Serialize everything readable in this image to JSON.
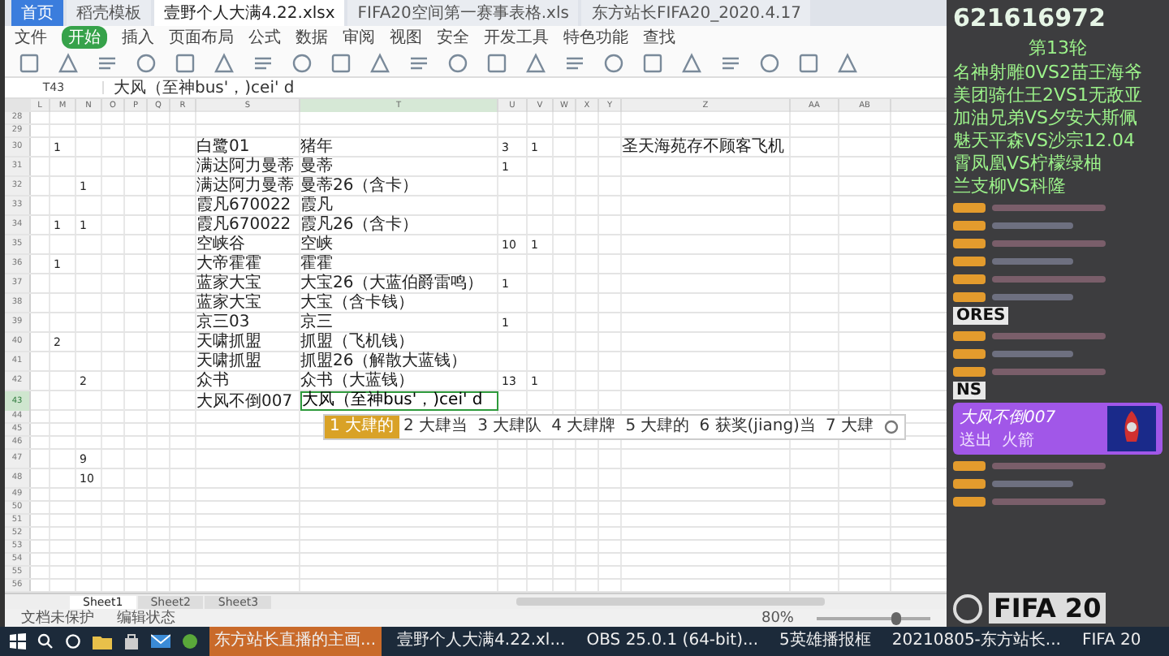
{
  "window": {
    "doc_tabs": [
      {
        "label": "首页",
        "selected": false
      },
      {
        "label": "稻壳模板",
        "selected": false
      },
      {
        "label": "壹野个人大满4.22.xlsx",
        "selected": true
      },
      {
        "label": "FIFA20空间第一赛事表格.xls",
        "selected": false
      },
      {
        "label": "东方站长FIFA20_2020.4.17",
        "selected": false
      }
    ],
    "menu": [
      {
        "label": "文件",
        "selected": false
      },
      {
        "label": "开始",
        "selected": true
      },
      {
        "label": "插入",
        "selected": false
      },
      {
        "label": "页面布局",
        "selected": false
      },
      {
        "label": "公式",
        "selected": false
      },
      {
        "label": "数据",
        "selected": false
      },
      {
        "label": "审阅",
        "selected": false
      },
      {
        "label": "视图",
        "selected": false
      },
      {
        "label": "安全",
        "selected": false
      },
      {
        "label": "开发工具",
        "selected": false
      },
      {
        "label": "特色功能",
        "selected": false
      },
      {
        "label": "查找",
        "selected": false
      }
    ],
    "cell_ref": "T43",
    "formula": "大风（至神bus'，)cei' d"
  },
  "sheet": {
    "columns": [
      "L",
      "M",
      "N",
      "O",
      "P",
      "Q",
      "R",
      "S",
      "T",
      "U",
      "V",
      "W",
      "X",
      "Y",
      "Z",
      "AA",
      "AB"
    ],
    "rows": [
      {
        "num": "28",
        "editing": false,
        "cells": []
      },
      {
        "num": "29",
        "editing": false,
        "cells": []
      },
      {
        "num": "30",
        "editing": false,
        "cells": [
          "",
          "1",
          "",
          "",
          "",
          "",
          "",
          "白鹭01",
          "猪年",
          "3",
          "1",
          "",
          "",
          "",
          "圣天海苑存不顾客飞机"
        ]
      },
      {
        "num": "31",
        "editing": false,
        "cells": [
          "",
          "",
          "",
          "",
          "",
          "",
          "",
          "满达阿力曼蒂",
          "曼蒂",
          "1"
        ]
      },
      {
        "num": "32",
        "editing": false,
        "cells": [
          "",
          "",
          "1",
          "",
          "",
          "",
          "",
          "满达阿力曼蒂",
          "曼蒂26（含卡）"
        ]
      },
      {
        "num": "33",
        "editing": false,
        "cells": [
          "",
          "",
          "",
          "",
          "",
          "",
          "",
          "霞凡670022",
          "霞凡"
        ]
      },
      {
        "num": "34",
        "editing": false,
        "cells": [
          "",
          "1",
          "1",
          "",
          "",
          "",
          "",
          "霞凡670022",
          "霞凡26（含卡）"
        ]
      },
      {
        "num": "35",
        "editing": false,
        "cells": [
          "",
          "",
          "",
          "",
          "",
          "",
          "",
          "空峡谷",
          "空峡",
          "10",
          "1"
        ]
      },
      {
        "num": "36",
        "editing": false,
        "cells": [
          "",
          "1",
          "",
          "",
          "",
          "",
          "",
          "大帝霍霍",
          "霍霍"
        ]
      },
      {
        "num": "37",
        "editing": false,
        "cells": [
          "",
          "",
          "",
          "",
          "",
          "",
          "",
          "蓝家大宝",
          "大宝26（大蓝伯爵雷鸣）",
          "1"
        ]
      },
      {
        "num": "38",
        "editing": false,
        "cells": [
          "",
          "",
          "",
          "",
          "",
          "",
          "",
          "蓝家大宝",
          "大宝（含卡钱）"
        ]
      },
      {
        "num": "39",
        "editing": false,
        "cells": [
          "",
          "",
          "",
          "",
          "",
          "",
          "",
          "京三03",
          "京三",
          "1"
        ]
      },
      {
        "num": "40",
        "editing": false,
        "cells": [
          "",
          "2",
          "",
          "",
          "",
          "",
          "",
          "天啸抓盟",
          "抓盟（飞机钱）"
        ]
      },
      {
        "num": "41",
        "editing": false,
        "cells": [
          "",
          "",
          "",
          "",
          "",
          "",
          "",
          "天啸抓盟",
          "抓盟26（解散大蓝钱）"
        ]
      },
      {
        "num": "42",
        "editing": false,
        "cells": [
          "",
          "",
          "2",
          "",
          "",
          "",
          "",
          "众书",
          "众书（大蓝钱）",
          "13",
          "1"
        ]
      },
      {
        "num": "43",
        "editing": true,
        "cells": [
          "",
          "",
          "",
          "",
          "",
          "",
          "",
          "大风不倒007",
          "大风（至神bus'，)cei' d"
        ]
      },
      {
        "num": "44",
        "editing": false,
        "cells": []
      },
      {
        "num": "45",
        "editing": false,
        "cells": []
      },
      {
        "num": "46",
        "editing": false,
        "cells": []
      },
      {
        "num": "47",
        "editing": false,
        "cells": [
          "",
          "",
          "9"
        ]
      },
      {
        "num": "48",
        "editing": false,
        "cells": [
          "",
          "",
          "10"
        ]
      },
      {
        "num": "49",
        "editing": false,
        "cells": []
      },
      {
        "num": "50",
        "editing": false,
        "cells": []
      },
      {
        "num": "51",
        "editing": false,
        "cells": []
      },
      {
        "num": "52",
        "editing": false,
        "cells": []
      },
      {
        "num": "53",
        "editing": false,
        "cells": []
      },
      {
        "num": "54",
        "editing": false,
        "cells": []
      },
      {
        "num": "55",
        "editing": false,
        "cells": []
      },
      {
        "num": "56",
        "editing": false,
        "cells": []
      }
    ]
  },
  "ime": {
    "candidates": [
      {
        "label": "1 大肆的",
        "selected": true
      },
      {
        "label": "2 大肆当",
        "selected": false
      },
      {
        "label": "3 大肆队",
        "selected": false
      },
      {
        "label": "4 大肆牌",
        "selected": false
      },
      {
        "label": "5 大肆的",
        "selected": false
      },
      {
        "label": "6 获奖(jiang)当",
        "selected": false
      },
      {
        "label": "7 大肆",
        "selected": false
      }
    ]
  },
  "sheet_tabs": [
    {
      "label": "Sheet1",
      "selected": true
    },
    {
      "label": "Sheet2",
      "selected": false
    },
    {
      "label": "Sheet3",
      "selected": false
    }
  ],
  "status_bar": {
    "protection": "文档未保护",
    "mode": "编辑状态",
    "zoom": "80%",
    "level": 0.7
  },
  "overlay": {
    "room_id": "621616972",
    "round": "第13轮",
    "matches": [
      "名神射雕0VS2苗王海爷",
      "美团骑仕王2VS1无敌亚",
      "加油兄弟VS夕安大斯佩",
      "魅天平森VS沙宗12.04",
      "霄凤凰VS柠檬绿柚",
      "兰支柳VS科隆"
    ],
    "game_text": [
      "ORES",
      "NS"
    ],
    "gift": {
      "user": "大风不倒007",
      "action": "送出",
      "item": "火箭"
    },
    "logo": "FIFA 20"
  },
  "taskbar": {
    "items": [
      {
        "label": "东方站长直播的主画...",
        "selected": true
      },
      {
        "label": "壹野个人大满4.22.xl...",
        "selected": false
      },
      {
        "label": "OBS 25.0.1 (64-bit)...",
        "selected": false
      },
      {
        "label": "5英雄播报框",
        "selected": false
      },
      {
        "label": "20210805-东方站长...",
        "selected": false
      },
      {
        "label": "FIFA 20",
        "selected": false
      }
    ]
  }
}
